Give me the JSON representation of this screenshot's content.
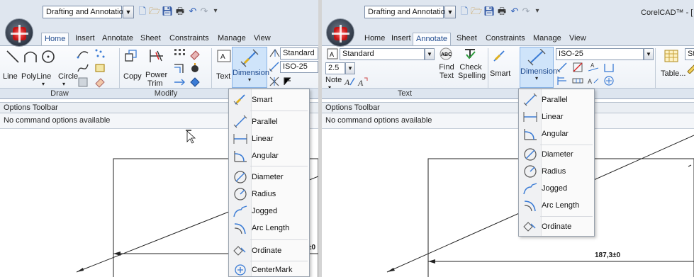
{
  "left": {
    "workspace": "Drafting and Annotation",
    "tabs": [
      "Home",
      "Insert",
      "Annotate",
      "Sheet",
      "Constraints",
      "Manage",
      "View"
    ],
    "active_tab": "Home",
    "draw_buttons": [
      "Line",
      "PolyLine",
      "Circle"
    ],
    "modify_buttons": [
      "Copy",
      "Power",
      "Trim"
    ],
    "text_button": "Text",
    "dimension_button": "Dimension",
    "style_combos": [
      "Standard",
      "ISO-25"
    ],
    "groups": [
      "Draw",
      "Modify"
    ],
    "options_toolbar": "Options Toolbar",
    "options_message": "No command options available",
    "dimension_value": "±0",
    "menu_items": [
      "Smart",
      "Parallel",
      "Linear",
      "Angular",
      "Diameter",
      "Radius",
      "Jogged",
      "Arc Length",
      "Ordinate",
      "CenterMark"
    ]
  },
  "right": {
    "workspace": "Drafting and Annotation",
    "app_title": "CorelCAD™ - [",
    "tabs": [
      "Home",
      "Insert",
      "Annotate",
      "Sheet",
      "Constraints",
      "Manage",
      "View"
    ],
    "active_tab": "Annotate",
    "text_style": "Standard",
    "text_height": "2.5",
    "note_button": "Note",
    "find_button": "Find\nText",
    "check_button": "Check\nSpelling",
    "smart_button": "Smart",
    "dimension_button": "Dimension",
    "dim_style": "ISO-25",
    "table_button": "Table...",
    "table_style": "Stand",
    "groups": [
      "Text"
    ],
    "options_toolbar": "Options Toolbar",
    "options_message": "No command options available",
    "dimension_value": "187,3±0",
    "menu_items": [
      "Parallel",
      "Linear",
      "Angular",
      "Diameter",
      "Radius",
      "Jogged",
      "Arc Length",
      "Ordinate"
    ]
  },
  "colors": {
    "accent": "#1e4a8e",
    "highlight": "#cfe4fa",
    "logo": "#c31414"
  }
}
